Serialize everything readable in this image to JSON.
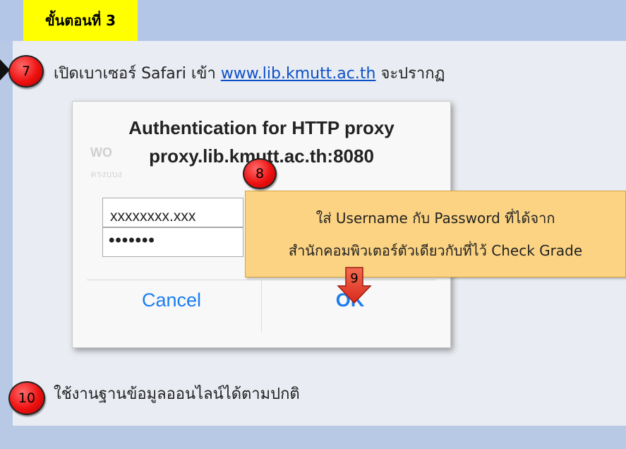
{
  "header": {
    "step_title": "ขั้นตอนที่ 3"
  },
  "steps": [
    {
      "number": "7",
      "text_before": "เปิดเบาเซอร์ Safari เข้า ",
      "link": "www.lib.kmutt.ac.th",
      "text_after": " จะปรากฏ"
    },
    {
      "number": "8"
    },
    {
      "number": "9"
    },
    {
      "number": "10",
      "text": "ใช้งานฐานข้อมูลออนไลน์ได้ตามปกติ"
    }
  ],
  "dialog": {
    "title": "Authentication for HTTP proxy",
    "host": "proxy.lib.kmutt.ac.th:8080",
    "username_value": "xxxxxxxx.xxx",
    "password_value": "•••••••",
    "cancel_label": "Cancel",
    "ok_label": "OK"
  },
  "callout": {
    "line1": "ใส่ Username กับ Password ที่ได้จาก",
    "line2": "สำนักคอมพิวเตอร์ตัวเดียวกับที่ไว้ Check Grade"
  },
  "colors": {
    "badge": "#ee1111",
    "header_bg": "#ffff00",
    "link": "#0b50c8",
    "ios_blue": "#1a7ef0",
    "callout_bg": "#fbd383",
    "arrow": "#e8382a"
  }
}
